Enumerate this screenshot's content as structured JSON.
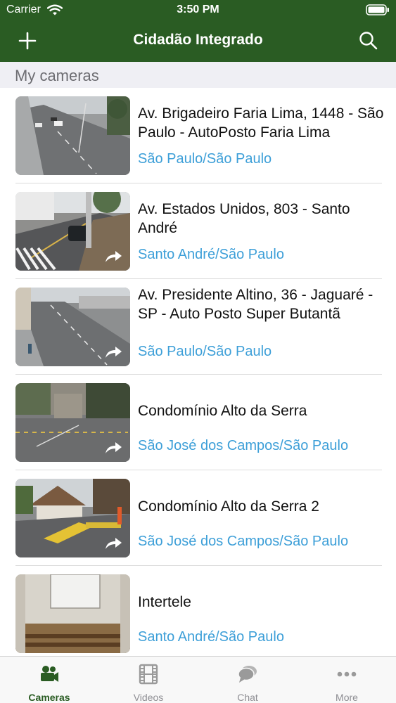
{
  "status_bar": {
    "carrier": "Carrier",
    "time": "3:50 PM"
  },
  "nav": {
    "title": "Cidadão Integrado",
    "left_icon": "plus-icon",
    "right_icon": "search-icon"
  },
  "colors": {
    "brand_green": "#2a5c23",
    "link_blue": "#3d9fd8",
    "section_bg": "#efeff4"
  },
  "section": {
    "title": "My cameras"
  },
  "cameras": [
    {
      "title": "Av. Brigadeiro Faria Lima, 1448 - São Paulo - AutoPosto Faria Lima",
      "location": "São Paulo/São Paulo",
      "shared": false
    },
    {
      "title": "Av. Estados Unidos, 803 - Santo André",
      "location": "Santo André/São Paulo",
      "shared": true
    },
    {
      "title": "Av. Presidente Altino, 36 - Jaguaré - SP - Auto Posto Super Butantã",
      "location": "São Paulo/São Paulo",
      "shared": true
    },
    {
      "title": "Condomínio Alto da Serra",
      "location": "São José dos Campos/São Paulo",
      "shared": true
    },
    {
      "title": "Condomínio Alto da Serra 2",
      "location": "São José dos Campos/São Paulo",
      "shared": true
    },
    {
      "title": "Intertele",
      "location": "Santo André/São Paulo",
      "shared": false
    }
  ],
  "tabs": [
    {
      "label": "Cameras",
      "icon": "camera-icon",
      "active": true
    },
    {
      "label": "Videos",
      "icon": "film-icon",
      "active": false
    },
    {
      "label": "Chat",
      "icon": "chat-icon",
      "active": false
    },
    {
      "label": "More",
      "icon": "more-icon",
      "active": false
    }
  ]
}
